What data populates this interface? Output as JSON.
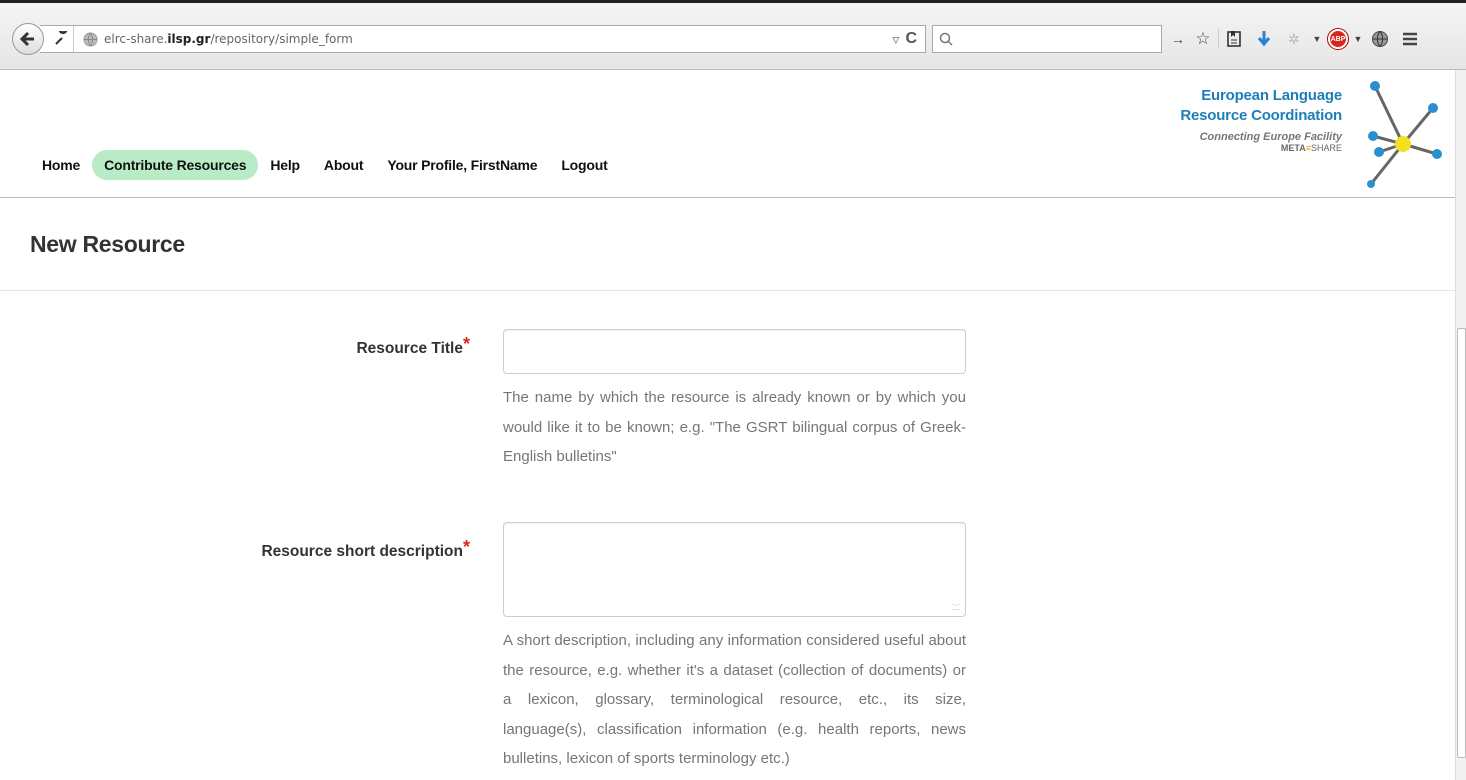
{
  "browser": {
    "url_prefix": "elrc-share.",
    "url_domain": "ilsp.gr",
    "url_path": "/repository/simple_form",
    "url_dropdown": "▿",
    "reload_glyph": "C",
    "search_placeholder": "",
    "abp_label": "ABP"
  },
  "nav": {
    "items": [
      {
        "label": "Home"
      },
      {
        "label": "Contribute Resources"
      },
      {
        "label": "Help"
      },
      {
        "label": "About"
      },
      {
        "label": "Your Profile, FirstName"
      },
      {
        "label": "Logout"
      }
    ],
    "active_index": 1
  },
  "logo": {
    "line1": "European Language",
    "line2": "Resource Coordination",
    "line3": "Connecting Europe Facility",
    "line4_meta": "META",
    "line4_share": "SHARE",
    "accent": "#1e7fb8",
    "node_color": "#2a8fd0",
    "center_color": "#f5e020"
  },
  "page": {
    "title": "New Resource"
  },
  "form": {
    "resource_title": {
      "label": "Resource Title",
      "required_mark": "*",
      "value": "",
      "help": "The name by which the resource is already known or by which you would like it to be known; e.g. \"The GSRT bilingual corpus of Greek-English bulletins\""
    },
    "short_description": {
      "label": "Resource short description",
      "required_mark": "*",
      "value": "",
      "help": "A short description, including any information considered useful about the resource, e.g. whether it's a dataset (collection of documents) or a lexicon, glossary, terminological resource, etc., its size, language(s), classification information (e.g. health reports, news bulletins, lexicon of sports terminology etc.)"
    }
  },
  "colors": {
    "active_nav_bg": "#b9ecc6",
    "required": "#d9261c"
  }
}
